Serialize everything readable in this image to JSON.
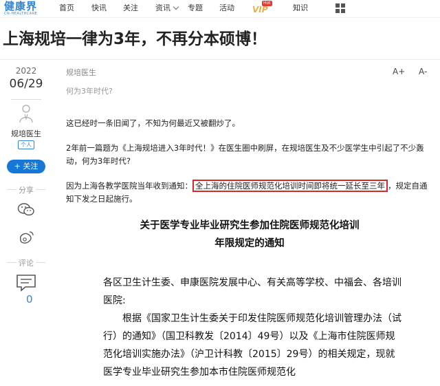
{
  "nav": {
    "logo_cn": "健康界",
    "logo_en": "CN-HEALTHCARE",
    "items": [
      "首页",
      "快讯",
      "关注",
      "资讯",
      "专题",
      "活动",
      "知识"
    ],
    "vip_label": "VIP",
    "vip_badge": "Hot"
  },
  "article": {
    "title": "上海规培一律为3年，不再分本硕博！",
    "year": "2022",
    "date": "06/29",
    "author": "规培医生",
    "author_tag": "个人",
    "follow_label": "+ 关注",
    "share_label": "分享",
    "comment_label": "评论",
    "comment_count": "0",
    "category": "规培医生",
    "subtitle": "何为3年时代?",
    "font_larger": "A+",
    "font_smaller": "A-",
    "p1": "这已经时一条旧闻了，不知为何最近又被翻炒了。",
    "p2": "2年前一篇题为《上海规培进入3年时代！》在医生圈中刷屏，在规培医生及不少医学生中引起了不少轰动，何为3年时代?",
    "p3_before": "因为上海各教学医院当年收到通知：",
    "p3_highlight": "全上海的住院医师规范化培训时间即将统一延长至三年",
    "p3_after": "，规定自通知下发之日起施行。",
    "doc_title_line1": "关于医学专业毕业研究生参加住院医师规范化培训",
    "doc_title_line2": "年限规定的通知",
    "doc_recipients": "各区卫生计生委、申康医院发展中心、有关高等学校、中福会、各培训医院:",
    "doc_body": "根据《国家卫生计生委关于印发住院医师规范化培训管理办法（试行）的通知》（国卫科教发〔2014〕49号）以及《上海市住院医师规范化培训实施办法》（沪卫计科教〔2015〕29号）的相关规定，现就医学专业毕业研究生参加本市住院医师规范化"
  }
}
